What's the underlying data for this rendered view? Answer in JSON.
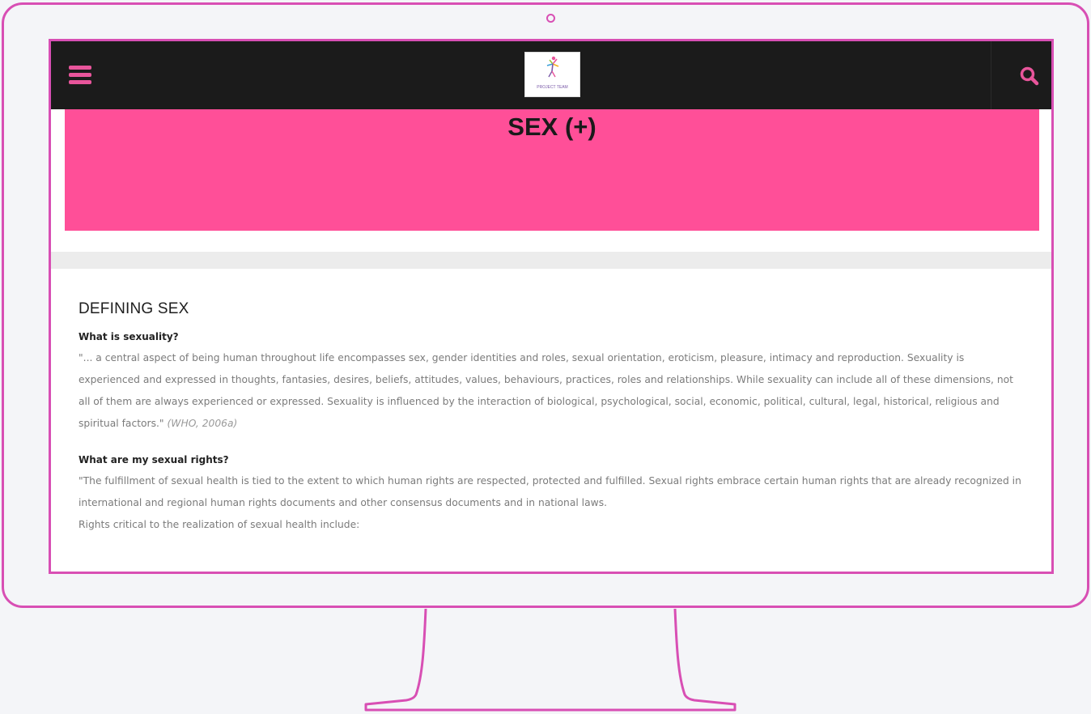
{
  "header": {
    "logo_text": "PROJECT TEAM",
    "menu_icon": "hamburger-menu-icon",
    "search_icon": "search-icon"
  },
  "hero": {
    "title": "SEX (+)"
  },
  "main": {
    "section_heading": "DEFINING SEX",
    "q1": {
      "heading": "What is sexuality?",
      "text": "\"... a central aspect of being human throughout life encompasses sex, gender identities and roles, sexual orientation, eroticism, pleasure, intimacy and reproduction. Sexuality is experienced and expressed in thoughts, fantasies, desires, beliefs, attitudes, values, behaviours, practices, roles and relationships. While sexuality can include all of these dimensions, not all of them are always experienced or expressed. Sexuality is influenced by the interaction of biological, psychological, social, economic, political, cultural, legal, historical, religious and spiritual factors.\"",
      "citation": "(WHO, 2006a)"
    },
    "q2": {
      "heading": "What are my sexual rights?",
      "text": "\"The fulfillment of sexual health is tied to the extent to which human rights are respected, protected and fulfilled. Sexual rights embrace certain human rights that are already recognized in international and regional human rights documents and other consensus documents and in national laws.",
      "text2": "Rights critical to the realization of sexual health include:"
    }
  },
  "colors": {
    "accent": "#e8559b",
    "hero_bg": "#ff4f98",
    "frame": "#d84fb4",
    "topbar": "#1b1b1b"
  }
}
